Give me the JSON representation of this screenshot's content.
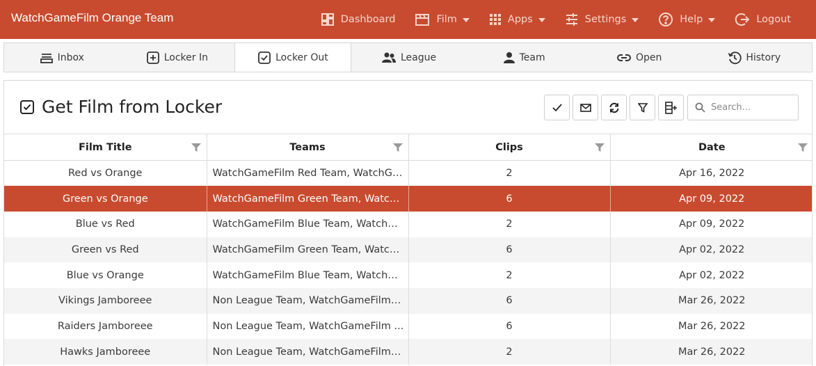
{
  "app": {
    "title": "WatchGameFilm Orange Team"
  },
  "nav": {
    "items": [
      {
        "label": "Dashboard",
        "icon": "dashboard-icon",
        "dropdown": false
      },
      {
        "label": "Film",
        "icon": "clapperboard-icon",
        "dropdown": true
      },
      {
        "label": "Apps",
        "icon": "apps-grid-icon",
        "dropdown": true
      },
      {
        "label": "Settings",
        "icon": "sliders-icon",
        "dropdown": true
      },
      {
        "label": "Help",
        "icon": "help-circle-icon",
        "dropdown": true
      },
      {
        "label": "Logout",
        "icon": "logout-icon",
        "dropdown": false
      }
    ]
  },
  "tabs": [
    {
      "label": "Inbox",
      "icon": "inbox-icon",
      "active": false
    },
    {
      "label": "Locker In",
      "icon": "plus-square-icon",
      "active": false
    },
    {
      "label": "Locker Out",
      "icon": "check-square-icon",
      "active": true
    },
    {
      "label": "League",
      "icon": "users-icon",
      "active": false
    },
    {
      "label": "Team",
      "icon": "user-icon",
      "active": false
    },
    {
      "label": "Open",
      "icon": "link-icon",
      "active": false
    },
    {
      "label": "History",
      "icon": "history-icon",
      "active": false
    }
  ],
  "page": {
    "title": "Get Film from Locker",
    "icon": "check-square-icon"
  },
  "toolbar": {
    "buttons": [
      "check-icon",
      "mail-icon",
      "refresh-icon",
      "filter-icon",
      "add-column-icon"
    ],
    "search_placeholder": "Search..."
  },
  "table": {
    "columns": [
      "Film Title",
      "Teams",
      "Clips",
      "Date"
    ],
    "rows": [
      {
        "title": "Red vs Orange",
        "teams": "WatchGameFilm Red Team, WatchGa...",
        "clips": "2",
        "date": "Apr 16, 2022"
      },
      {
        "title": "Green vs Orange",
        "teams": "WatchGameFilm Green Team, Watch...",
        "clips": "6",
        "date": "Apr 09, 2022"
      },
      {
        "title": "Blue vs Red",
        "teams": "WatchGameFilm Blue Team, WatchGa...",
        "clips": "2",
        "date": "Apr 09, 2022"
      },
      {
        "title": "Green vs Red",
        "teams": "WatchGameFilm Green Team, Watch...",
        "clips": "6",
        "date": "Apr 02, 2022"
      },
      {
        "title": "Blue vs Orange",
        "teams": "WatchGameFilm Blue Team, WatchGa...",
        "clips": "2",
        "date": "Apr 02, 2022"
      },
      {
        "title": "Vikings Jamboreee",
        "teams": "Non League Team, WatchGameFilm B...",
        "clips": "6",
        "date": "Mar 26, 2022"
      },
      {
        "title": "Raiders Jamboreee",
        "teams": "Non League Team, WatchGameFilm ...",
        "clips": "6",
        "date": "Mar 26, 2022"
      },
      {
        "title": "Hawks Jamboreee",
        "teams": "Non League Team, WatchGameFilm R...",
        "clips": "2",
        "date": "Mar 26, 2022"
      }
    ],
    "selected_row": 1
  },
  "colors": {
    "brand": "#c84b2f",
    "nav_text": "#f6d6cd",
    "alt_row": "#f4f4f4"
  }
}
